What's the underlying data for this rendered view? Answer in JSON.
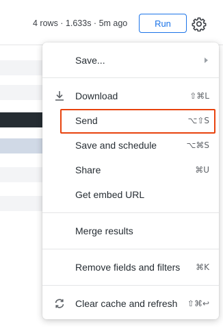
{
  "header": {
    "status": "4 rows · 1.633s · 5m ago",
    "run_label": "Run",
    "gear_icon": "gear-icon"
  },
  "background_rows": [
    {
      "color": "#f3f4f6"
    },
    {
      "color": "#f3f4f6"
    },
    {
      "color": "#262d33"
    },
    {
      "color": "#d0d9e6"
    },
    {
      "color": "#f3f4f6"
    },
    {
      "color": "#f3f4f6"
    }
  ],
  "menu": {
    "items": [
      {
        "label": "Save...",
        "shortcut": "",
        "icon": "",
        "has_submenu": true
      },
      {
        "label": "Download",
        "shortcut": "⇧⌘L",
        "icon": "download-icon"
      },
      {
        "label": "Send",
        "shortcut": "⌥⇧S",
        "icon": "",
        "highlighted": true
      },
      {
        "label": "Save and schedule",
        "shortcut": "⌥⌘S",
        "icon": ""
      },
      {
        "label": "Share",
        "shortcut": "⌘U",
        "icon": ""
      },
      {
        "label": "Get embed URL",
        "shortcut": "",
        "icon": ""
      },
      {
        "label": "Merge results",
        "shortcut": "",
        "icon": ""
      },
      {
        "label": "Remove fields and filters",
        "shortcut": "⌘K",
        "icon": ""
      },
      {
        "label": "Clear cache and refresh",
        "shortcut": "⇧⌘↩",
        "icon": "refresh-icon"
      }
    ]
  },
  "colors": {
    "accent": "#1a73e8",
    "highlight_border": "#e8420d"
  }
}
